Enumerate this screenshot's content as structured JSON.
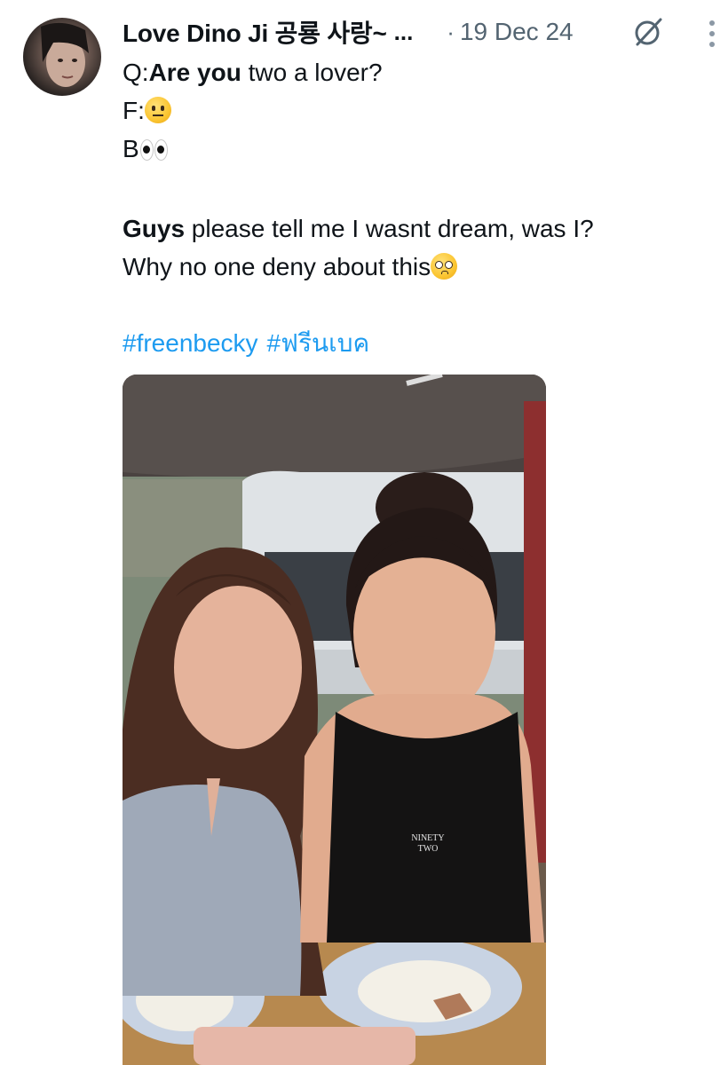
{
  "tweet": {
    "author_name": "Love Dino Ji 공룡 사랑~",
    "author_more": "...",
    "dot": "·",
    "date": "19 Dec 24",
    "lines": {
      "q_prefix": "Q:",
      "q_bold": "Are you",
      "q_rest": " two a lover?",
      "f_prefix": "F:",
      "b_prefix": "B",
      "guys_bold": "Guys",
      "guys_rest": " please tell me I wasnt dream, was I?",
      "why": "Why no one deny about this"
    },
    "hashtags": [
      "#freenbecky",
      "#ฟรีนเบค"
    ],
    "emojis": {
      "f": "neutral-face",
      "b": "eyes",
      "why": "pleading-face"
    },
    "media": {
      "shirt_text_1": "NINETY",
      "shirt_text_2": "TWO"
    },
    "icons": {
      "grok": "grok-icon",
      "menu": "more-vertical-icon"
    },
    "colors": {
      "link": "#1d9bf0",
      "secondary": "#536471",
      "text": "#0f1419"
    }
  }
}
